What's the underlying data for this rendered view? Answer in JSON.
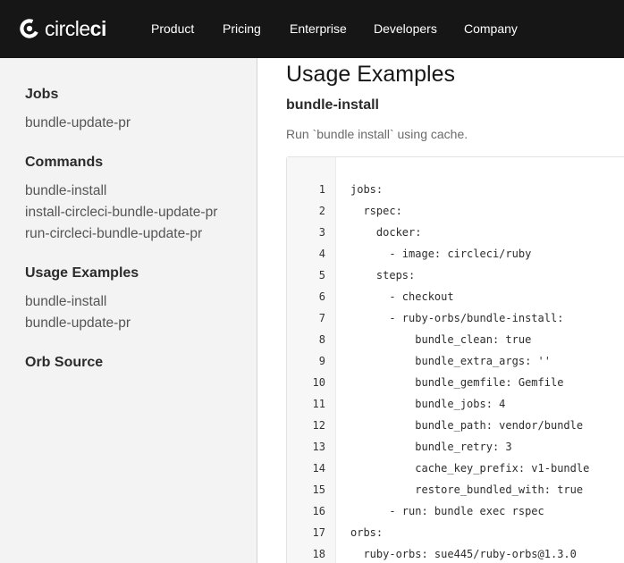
{
  "header": {
    "logo_text_light": "circle",
    "logo_text_bold": "ci",
    "nav": [
      "Product",
      "Pricing",
      "Enterprise",
      "Developers",
      "Company"
    ]
  },
  "sidebar": {
    "sections": [
      {
        "heading": "Jobs",
        "items": [
          "bundle-update-pr"
        ]
      },
      {
        "heading": "Commands",
        "items": [
          "bundle-install",
          "install-circleci-bundle-update-pr",
          "run-circleci-bundle-update-pr"
        ]
      },
      {
        "heading": "Usage Examples",
        "items": [
          "bundle-install",
          "bundle-update-pr"
        ]
      },
      {
        "heading": "Orb Source",
        "items": []
      }
    ]
  },
  "main": {
    "title": "Usage Examples",
    "example_name": "bundle-install",
    "description": "Run `bundle install` using cache.",
    "code": {
      "line_numbers": [
        "1",
        "2",
        "3",
        "4",
        "5",
        "6",
        "7",
        "8",
        "9",
        "10",
        "11",
        "12",
        "13",
        "14",
        "15",
        "16",
        "17",
        "18"
      ],
      "lines": [
        "jobs:",
        "  rspec:",
        "    docker:",
        "      - image: circleci/ruby",
        "    steps:",
        "      - checkout",
        "      - ruby-orbs/bundle-install:",
        "          bundle_clean: true",
        "          bundle_extra_args: ''",
        "          bundle_gemfile: Gemfile",
        "          bundle_jobs: 4",
        "          bundle_path: vendor/bundle",
        "          bundle_retry: 3",
        "          cache_key_prefix: v1-bundle",
        "          restore_bundled_with: true",
        "      - run: bundle exec rspec",
        "orbs:",
        "  ruby-orbs: sue445/ruby-orbs@1.3.0"
      ]
    }
  }
}
